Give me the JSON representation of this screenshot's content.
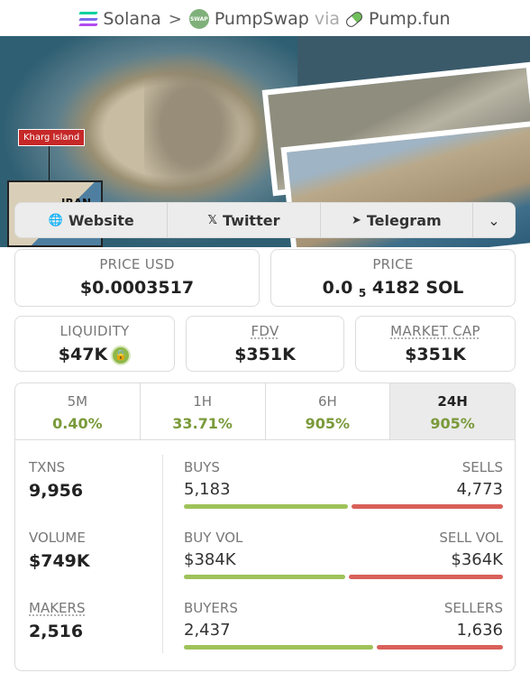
{
  "breadcrumb": {
    "chain": "Solana",
    "dex": "PumpSwap",
    "via": "via",
    "source": "Pump.fun",
    "dex_icon_text": "SWAP"
  },
  "banner": {
    "map_label": "Kharg Island",
    "inset_label": "IRAN"
  },
  "links": {
    "website": "Website",
    "twitter": "Twitter",
    "telegram": "Telegram"
  },
  "price": {
    "usd_label": "PRICE USD",
    "usd_value": "$0.0003517",
    "native_label": "PRICE",
    "native_prefix": "0.0",
    "native_zeros": "5",
    "native_digits": "4182 SOL"
  },
  "metrics": {
    "liquidity_label": "LIQUIDITY",
    "liquidity_value": "$47K",
    "fdv_label": "FDV",
    "fdv_value": "$351K",
    "mcap_label": "MARKET CAP",
    "mcap_value": "$351K"
  },
  "tabs": [
    {
      "label": "5M",
      "change": "0.40%"
    },
    {
      "label": "1H",
      "change": "33.71%"
    },
    {
      "label": "6H",
      "change": "905%"
    },
    {
      "label": "24H",
      "change": "905%"
    }
  ],
  "active_tab": "24H",
  "stats": {
    "txns_label": "TXNS",
    "txns_value": "9,956",
    "volume_label": "VOLUME",
    "volume_value": "$749K",
    "makers_label": "MAKERS",
    "makers_value": "2,516",
    "buys_label": "BUYS",
    "buys_value": "5,183",
    "sells_label": "SELLS",
    "sells_value": "4,773",
    "buy_vol_label": "BUY VOL",
    "buy_vol_value": "$384K",
    "sell_vol_label": "SELL VOL",
    "sell_vol_value": "$364K",
    "buyers_label": "BUYERS",
    "buyers_value": "2,437",
    "sellers_label": "SELLERS",
    "sellers_value": "1,636"
  },
  "ratios": {
    "buys_share": 0.52,
    "buy_vol_share": 0.51,
    "buyers_share": 0.6
  },
  "colors": {
    "buy": "#9fc25a",
    "sell": "#d9605a",
    "positive": "#7a9a3a"
  }
}
